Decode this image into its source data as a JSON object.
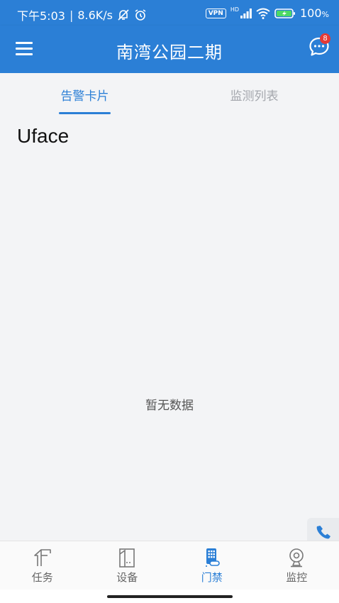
{
  "status_bar": {
    "time": "下午5:03",
    "net_speed": "8.6K/s",
    "vpn": "VPN",
    "signal_hd": "HD",
    "battery": "100",
    "battery_unit": "%"
  },
  "app_bar": {
    "title": "南湾公园二期",
    "message_count": "8"
  },
  "tabs": [
    {
      "label": "告警卡片",
      "active": true
    },
    {
      "label": "监测列表",
      "active": false
    }
  ],
  "content": {
    "device_name": "Uface",
    "empty_text": "暂无数据"
  },
  "bottom_nav": [
    {
      "label": "任务",
      "icon": "task-icon",
      "active": false
    },
    {
      "label": "设备",
      "icon": "device-icon",
      "active": false
    },
    {
      "label": "门禁",
      "icon": "access-control-icon",
      "active": true
    },
    {
      "label": "监控",
      "icon": "camera-icon",
      "active": false
    }
  ],
  "colors": {
    "primary": "#2b7fd6",
    "badge": "#e53935",
    "background": "#f3f4f6",
    "inactive_tab": "#a4a7ad"
  }
}
